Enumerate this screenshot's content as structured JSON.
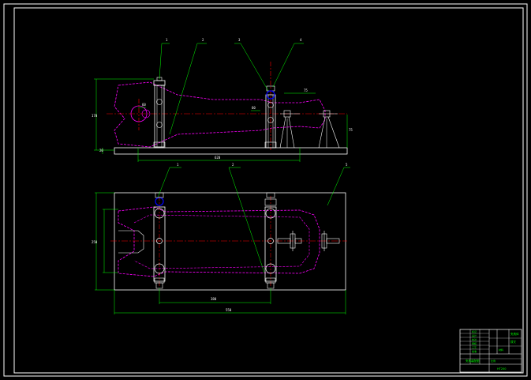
{
  "drawing": {
    "background": "#000000",
    "colors": {
      "frame": "#ffffff",
      "part_outline": "#ff00ff",
      "centerline": "#ff0000",
      "dimension": "#00ff00",
      "fixture": "#ffffff",
      "fastener": "#0000ff",
      "title_block": "#00ff00"
    },
    "top_view": {
      "balloons": [
        "1",
        "2",
        "3",
        "4"
      ],
      "dimensions": {
        "overall_height": "170",
        "base_thickness": "20",
        "overall_length": "620",
        "bore": "60",
        "bar": "60",
        "support_width": "75",
        "support_height": "75"
      }
    },
    "bottom_view": {
      "balloons": [
        "1",
        "2",
        "5"
      ],
      "dimensions": {
        "width": "250",
        "span": "380",
        "overall_length": "550"
      }
    },
    "title_block": {
      "rows_left": [
        "标记",
        "设计",
        "校对",
        "审核",
        "工艺",
        "批准"
      ],
      "rows_right": [
        "夹具体",
        "拨叉",
        "材料",
        "比例"
      ],
      "bottom_left": "夹具装配图",
      "bottom_right": "HT200"
    }
  }
}
